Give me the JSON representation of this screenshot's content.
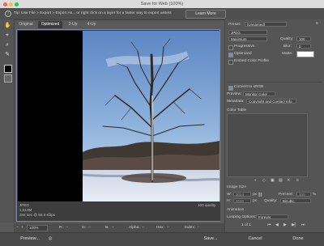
{
  "window": {
    "title": "Save for Web (100%)"
  },
  "tip": {
    "text": "Tip: Use File > Export > Export As... or right click on a layer for a faster way to export assets",
    "learn_more": "Learn More"
  },
  "tabs": [
    "Original",
    "Optimized",
    "2-Up",
    "4-Up"
  ],
  "tools": [
    "hand-tool",
    "slice-select-tool",
    "zoom-tool",
    "eyedropper-tool"
  ],
  "preview": {
    "format": "JPEG",
    "size": "1.513M",
    "time": "244 sec @ 56.6 Kbps",
    "quality": "100 quality"
  },
  "status": {
    "zoom": "100%",
    "r": "R:",
    "g": "G:",
    "b": "B:",
    "alpha": "Alpha:",
    "hex": "Hex:",
    "index": "Index:",
    "r_val": "--",
    "g_val": "--",
    "b_val": "--",
    "alpha_val": "--",
    "hex_val": "--",
    "index_val": "--"
  },
  "buttons": {
    "preview": "Preview...",
    "save": "Save...",
    "cancel": "Cancel",
    "done": "Done"
  },
  "settings": {
    "preset_label": "Preset:",
    "preset_value": "[Unnamed]",
    "format_value": "JPEG",
    "compression_value": "Maximum",
    "quality_label": "Quality:",
    "quality_value": "100",
    "progressive": "Progressive",
    "blur_label": "Blur:",
    "blur_value": "0",
    "optimized": "Optimized",
    "matte_label": "Matte:",
    "embed_profile": "Embed Color Profile",
    "convert_srgb": "Convert to sRGB",
    "preview_label": "Preview:",
    "preview_value": "Monitor Color",
    "metadata_label": "Metadata:",
    "metadata_value": "Copyright and Contact Info",
    "color_table": "Color Table",
    "image_size": "Image Size",
    "w_label": "W:",
    "w_value": "3024",
    "h_label": "H:",
    "h_value": "4032",
    "px": "px",
    "percent_label": "Percent:",
    "percent_value": "100",
    "pct": "%",
    "quality2_label": "Quality:",
    "quality2_value": "Bicubic",
    "animation": "Animation",
    "looping_label": "Looping Options:",
    "looping_value": "Forever",
    "frame_counter": "1 of 1"
  },
  "colors": {
    "accent": "#7c8aa8",
    "matte": "#ffffff"
  }
}
